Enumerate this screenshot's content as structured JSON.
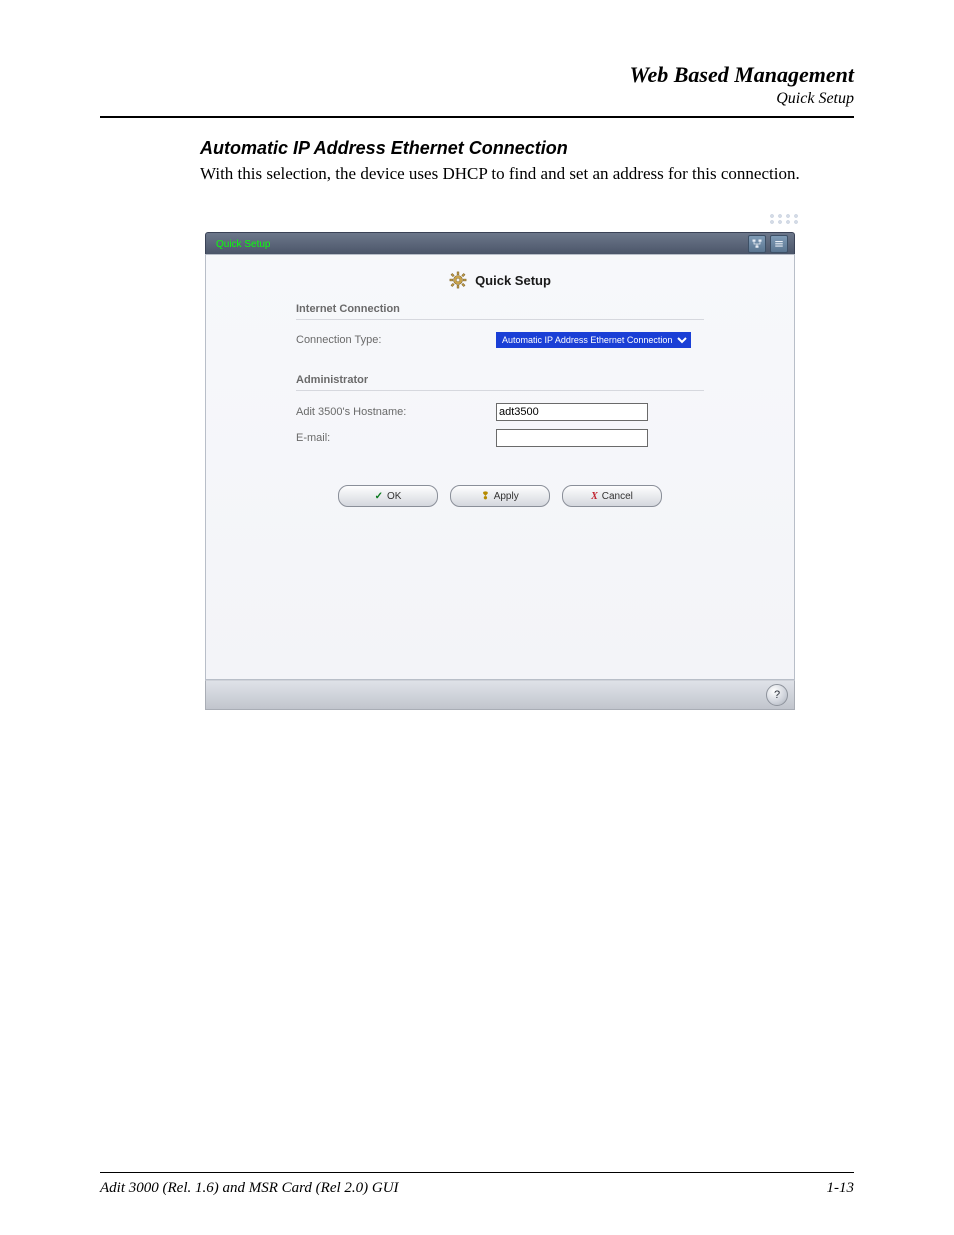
{
  "header": {
    "title": "Web Based Management",
    "subtitle": "Quick Setup"
  },
  "section": {
    "heading": "Automatic IP Address Ethernet Connection",
    "body": "With this selection, the device uses DHCP to find and set an address for this connection."
  },
  "window": {
    "tab_label": "Quick Setup",
    "panel_title": "Quick Setup",
    "groups": {
      "internet": {
        "label": "Internet Connection",
        "connection_type_label": "Connection Type:",
        "connection_type_value": "Automatic IP Address Ethernet Connection"
      },
      "admin": {
        "label": "Administrator",
        "hostname_label": "Adit 3500's Hostname:",
        "hostname_value": "adt3500",
        "email_label": "E-mail:",
        "email_value": ""
      }
    },
    "buttons": {
      "ok": "OK",
      "apply": "Apply",
      "cancel": "Cancel"
    },
    "help_label": "?"
  },
  "footer": {
    "left": "Adit 3000 (Rel. 1.6) and MSR Card (Rel 2.0) GUI",
    "right": "1-13"
  }
}
